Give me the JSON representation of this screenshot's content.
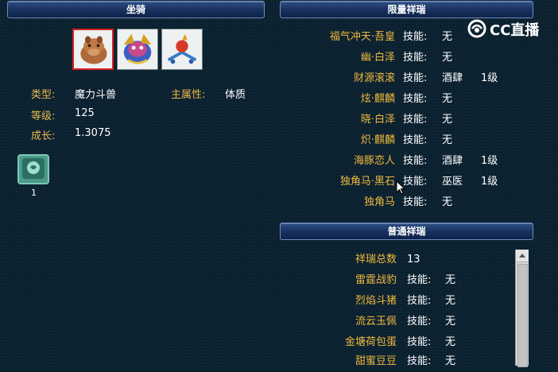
{
  "left_panel": {
    "title": "坐骑",
    "mounts": [
      {
        "icon": "boar-mount-icon",
        "selected": true
      },
      {
        "icon": "dragon-mount-icon",
        "selected": false
      },
      {
        "icon": "bird-mount-icon",
        "selected": false
      }
    ],
    "type_label": "类型:",
    "type_value": "魔力斗兽",
    "main_attr_label": "主属性:",
    "main_attr_value": "体质",
    "level_label": "等级:",
    "level_value": "125",
    "growth_label": "成长:",
    "growth_value": "1.3075",
    "item_count": "1"
  },
  "limited_panel": {
    "title": "限量祥瑞",
    "skill_label": "技能:",
    "rows": [
      {
        "name": "福气冲天·吾皇",
        "skill": "无",
        "level": ""
      },
      {
        "name": "幽·白泽",
        "skill": "无",
        "level": ""
      },
      {
        "name": "财源滚滚",
        "skill": "酒肆",
        "level": "1级"
      },
      {
        "name": "炫·麒麟",
        "skill": "无",
        "level": ""
      },
      {
        "name": "晓·白泽",
        "skill": "无",
        "level": ""
      },
      {
        "name": "炽·麒麟",
        "skill": "无",
        "level": ""
      },
      {
        "name": "海豚恋人",
        "skill": "酒肆",
        "level": "1级"
      },
      {
        "name": "独角马·黑石",
        "skill": "巫医",
        "level": "1级"
      },
      {
        "name": "独角马",
        "skill": "无",
        "level": ""
      }
    ]
  },
  "normal_panel": {
    "title": "普通祥瑞",
    "total_label": "祥瑞总数",
    "total_value": "13",
    "skill_label": "技能:",
    "rows": [
      {
        "name": "雷霆战豹",
        "skill": "无"
      },
      {
        "name": "烈焰斗猪",
        "skill": "无"
      },
      {
        "name": "流云玉佩",
        "skill": "无"
      },
      {
        "name": "金塘荷包蛋",
        "skill": "无"
      },
      {
        "name": "甜蜜豆豆",
        "skill": "无"
      }
    ]
  },
  "watermark": {
    "text": "CC直播"
  },
  "colors": {
    "label": "#e8b84a",
    "name": "#f0b93c",
    "background": "#0b2130"
  }
}
